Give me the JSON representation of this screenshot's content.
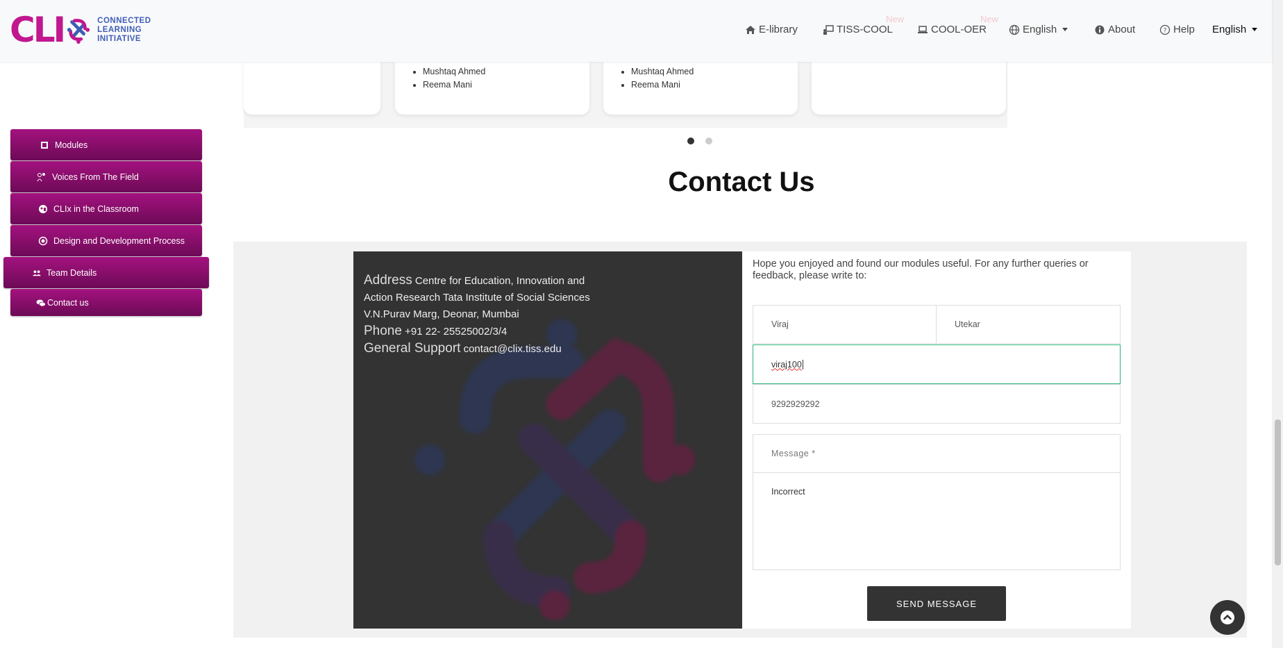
{
  "header": {
    "logo_letters": "CLI",
    "logo_lines": [
      "CONNECTED",
      "LEARNING",
      "INITIATIVE"
    ],
    "nav": [
      {
        "label": "E-library",
        "icon": "home-icon"
      },
      {
        "label": "TISS-COOL",
        "icon": "presentation-icon",
        "badge": "New"
      },
      {
        "label": "COOL-OER",
        "icon": "laptop-icon",
        "badge": "New"
      },
      {
        "label": "English",
        "icon": "globe-icon",
        "dropdown": true
      },
      {
        "label": "About",
        "icon": "info-icon"
      },
      {
        "label": "Help",
        "icon": "help-icon"
      }
    ],
    "language_selected": "English"
  },
  "cards": [
    {
      "names": [
        "Mushtaq Ahmed",
        "Reema Mani"
      ]
    },
    {
      "names": [
        "Mushtaq Ahmed",
        "Reema Mani"
      ]
    }
  ],
  "carousel": {
    "active_page": 1,
    "pages": 2
  },
  "section_title": "Contact Us",
  "sidebar": {
    "items": [
      {
        "label": "Modules",
        "icon": "module-icon"
      },
      {
        "label": "Voices From The Field",
        "icon": "people-icon"
      },
      {
        "label": "CLIx in the Classroom",
        "icon": "classroom-icon"
      },
      {
        "label": "Design and Development Process",
        "icon": "gear-icon"
      },
      {
        "label": "Team Details",
        "icon": "team-icon",
        "active": true
      },
      {
        "label": "Contact us",
        "icon": "chat-icon"
      }
    ]
  },
  "contact": {
    "address_label": "Address",
    "address_value": "Centre for Education, Innovation and Action Research Tata Institute of Social Sciences V.N.Purav Marg, Deonar, Mumbai",
    "phone_label": "Phone",
    "phone_value": "+91 22- 25525002/3/4",
    "support_label": "General Support",
    "support_value": "contact@clix.tiss.edu"
  },
  "form": {
    "intro": "Hope you enjoyed and found our modules useful. For any further queries or feedback, please write to:",
    "first_name": "Viraj",
    "last_name": "Utekar",
    "email": "viraj100",
    "phone": "9292929292",
    "message_placeholder": "Message *",
    "message_value": "Incorrect",
    "send_label": "SEND MESSAGE"
  },
  "colors": {
    "accent": "#a3127f",
    "focus": "#2ab27b",
    "dark": "#333333"
  }
}
